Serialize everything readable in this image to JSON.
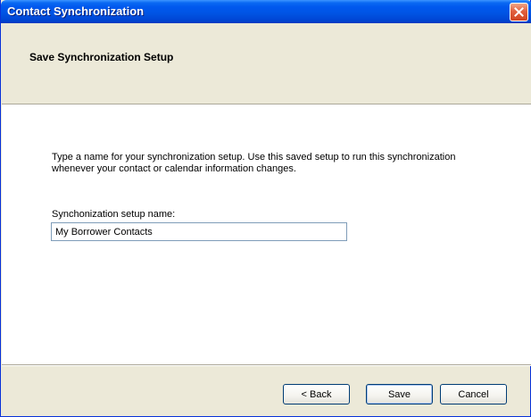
{
  "window": {
    "title": "Contact Synchronization",
    "close_icon": "close-icon"
  },
  "header": {
    "title": "Save Synchronization Setup"
  },
  "content": {
    "description": "Type a name for your synchronization setup. Use this saved setup to run this synchronization whenever your contact or calendar information changes.",
    "field_label": "Synchonization setup name:",
    "field_value": "My Borrower Contacts"
  },
  "buttons": {
    "back": "< Back",
    "save": "Save",
    "cancel": "Cancel"
  },
  "colors": {
    "titlebar": "#0055e5",
    "dialog_bg": "#ece9d8",
    "close": "#d2451f",
    "input_border": "#7f9db9"
  }
}
